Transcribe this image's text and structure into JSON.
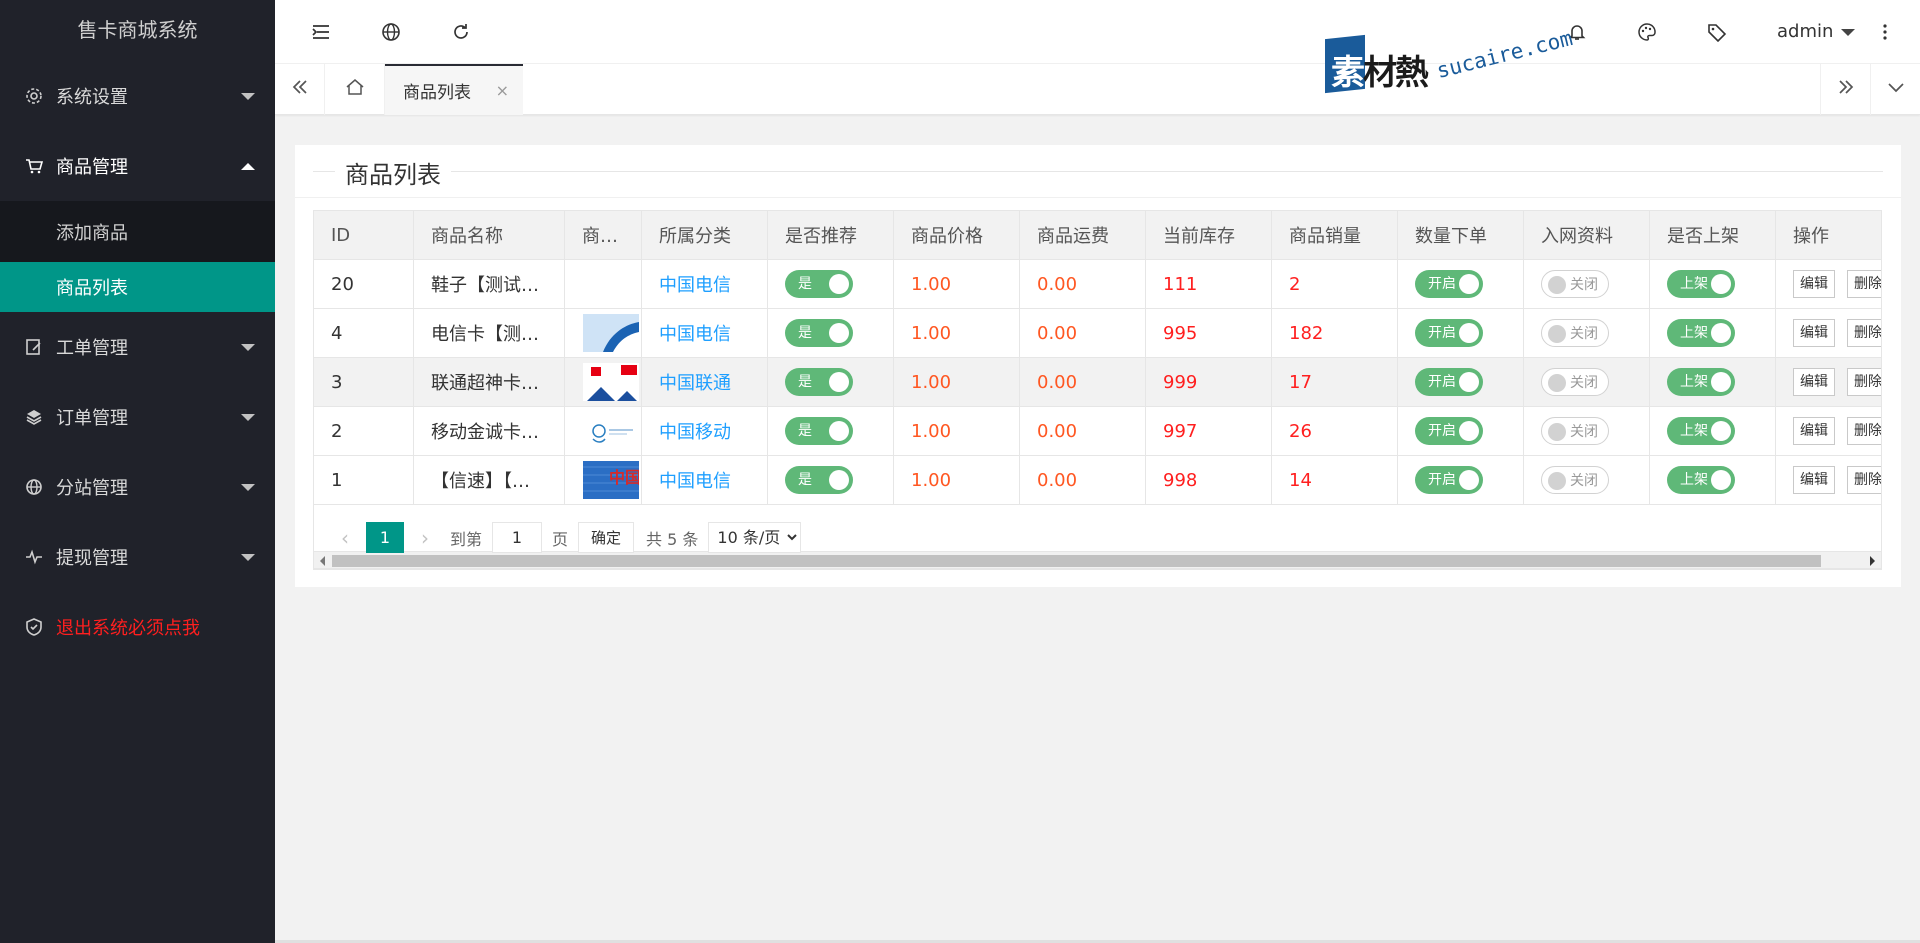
{
  "app": {
    "title": "售卡商城系统"
  },
  "colors": {
    "sidebar_bg": "#20222a",
    "accent": "#009688",
    "link": "#1e9fff",
    "price": "#ff5722",
    "number": "#ff1f1f",
    "switch_on": "#5fb878"
  },
  "sidebar": {
    "items": [
      {
        "label": "系统设置",
        "icon": "gear-icon"
      },
      {
        "label": "商品管理",
        "icon": "cart-icon"
      },
      {
        "label": "工单管理",
        "icon": "ticket-icon"
      },
      {
        "label": "订单管理",
        "icon": "layers-icon"
      },
      {
        "label": "分站管理",
        "icon": "globe-icon"
      },
      {
        "label": "提现管理",
        "icon": "pulse-icon"
      }
    ],
    "sub_items": [
      {
        "label": "添加商品"
      },
      {
        "label": "商品列表"
      }
    ],
    "logout": {
      "label": "退出系统必须点我",
      "icon": "shield-check-icon"
    }
  },
  "topbar": {
    "icons": [
      "menu-fold-icon",
      "globe-icon",
      "refresh-icon",
      "bell-icon",
      "palette-icon",
      "tag-icon",
      "more-vertical-icon"
    ],
    "user": "admin"
  },
  "tabs": {
    "current": "商品列表",
    "close": "×"
  },
  "watermark": {
    "cn": "素材熱",
    "cn_first": "素",
    "cn_rest": "材熱",
    "en": "sucaire.com"
  },
  "card": {
    "title": "商品列表"
  },
  "table": {
    "headers": [
      "ID",
      "商品名称",
      "商…",
      "所属分类",
      "是否推荐",
      "商品价格",
      "商品运费",
      "当前库存",
      "商品销量",
      "数量下单",
      "入网资料",
      "是否上架",
      "操作"
    ],
    "rows": [
      {
        "id": "20",
        "name": "鞋子【测试…",
        "category": "中国电信",
        "recommend": "是",
        "price": "1.00",
        "shipping": "0.00",
        "stock": "111",
        "sales": "2",
        "qty_order": "开启",
        "net_info": "关闭",
        "listed": "上架",
        "thumb": "none"
      },
      {
        "id": "4",
        "name": "电信卡【测…",
        "category": "中国电信",
        "recommend": "是",
        "price": "1.00",
        "shipping": "0.00",
        "stock": "995",
        "sales": "182",
        "qty_order": "开启",
        "net_info": "关闭",
        "listed": "上架",
        "thumb": "blue-wave"
      },
      {
        "id": "3",
        "name": "联通超神卡…",
        "category": "中国联通",
        "recommend": "是",
        "price": "1.00",
        "shipping": "0.00",
        "stock": "999",
        "sales": "17",
        "qty_order": "开启",
        "net_info": "关闭",
        "listed": "上架",
        "thumb": "unicom"
      },
      {
        "id": "2",
        "name": "移动金诚卡…",
        "category": "中国移动",
        "recommend": "是",
        "price": "1.00",
        "shipping": "0.00",
        "stock": "997",
        "sales": "26",
        "qty_order": "开启",
        "net_info": "关闭",
        "listed": "上架",
        "thumb": "mobile"
      },
      {
        "id": "1",
        "name": "【信速】【…",
        "category": "中国电信",
        "recommend": "是",
        "price": "1.00",
        "shipping": "0.00",
        "stock": "998",
        "sales": "14",
        "qty_order": "开启",
        "net_info": "关闭",
        "listed": "上架",
        "thumb": "telecom-blue"
      }
    ],
    "actions": {
      "edit": "编辑",
      "delete": "删除"
    }
  },
  "pager": {
    "current": "1",
    "goto_label": "到第",
    "goto_value": "1",
    "page_unit": "页",
    "confirm": "确定",
    "total": "共 5 条",
    "per_page": "10 条/页"
  }
}
